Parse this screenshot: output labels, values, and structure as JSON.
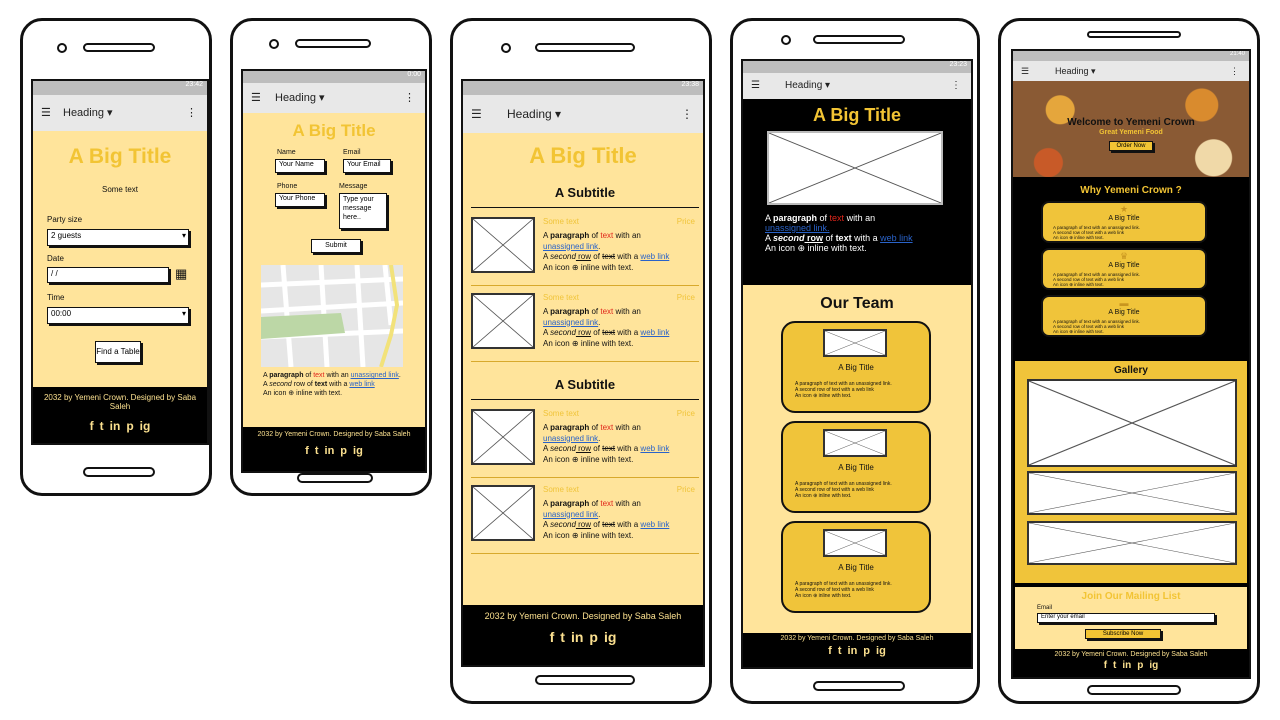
{
  "heading_label": "Heading",
  "menu_icon": "☰",
  "dropdown_icon": "▾",
  "overflow_icon": "⋮",
  "big_title": "A Big Title",
  "footer_text": "2032 by Yemeni Crown. Designed by Saba Saleh",
  "social_icons": [
    "f",
    "t",
    "in",
    "p",
    "ig"
  ],
  "phone1": {
    "time": "23:42",
    "some_text": "Some text",
    "party_label": "Party size",
    "party_value": "2 guests",
    "date_label": "Date",
    "date_value": " /  /",
    "time_label": "Time",
    "time_value": "00:00",
    "button": "Find a Table"
  },
  "phone2": {
    "time": "0:00",
    "name_label": "Name",
    "name_ph": "Your Name",
    "email_label": "Email",
    "email_ph": "Your Email",
    "phone_label": "Phone",
    "phone_ph": "Your Phone",
    "message_label": "Message",
    "message_ph": "Type your message here..",
    "submit": "Submit",
    "para1_a": "A ",
    "para1_b": "paragraph",
    "para1_c": " of ",
    "para1_d": "text",
    "para1_e": " with an ",
    "para1_f": "unassigned link",
    "para2_a": "A ",
    "para2_b": "second",
    "para2_c": " row of ",
    "para2_d": "text",
    "para2_e": " with a ",
    "para2_f": "web link",
    "para3": "An icon ⊕ inline with text."
  },
  "phone3": {
    "time": "23:38",
    "subtitle": "A Subtitle",
    "some_text": "Some text",
    "price": "Price",
    "l1_a": "A ",
    "l1_b": "paragraph",
    "l1_c": " of ",
    "l1_d": "text",
    "l1_e": " with an",
    "l2": "unassigned link",
    "l3_a": "A ",
    "l3_b": "second",
    "l3_c": " row",
    "l3_d": " of ",
    "l3_e": "text",
    "l3_f": " with a ",
    "l3_g": "web link",
    "l4": "An icon ⊕ inline with text."
  },
  "phone4": {
    "time": "23:23",
    "para_a": "A ",
    "para_b": "paragraph",
    "para_c": " of ",
    "para_d": "text",
    "para_e": " with an",
    "link1": "unassigned link.",
    "row2_a": "A ",
    "row2_b": "second",
    "row2_c": " row",
    "row2_d": " of ",
    "row2_e": "text",
    "row2_f": " with a ",
    "row2_g": "web link",
    "row3": "An icon ⊕ inline with text.",
    "team_title": "Our Team",
    "card_title": "A Big Title",
    "card_l1": "A paragraph of text with an unassigned link.",
    "card_l2": "A second row of text with a web link",
    "card_l3": "An icon ⊕ inline with text."
  },
  "phone5": {
    "time": "21:40",
    "hero_title": "Welcome to Yemeni Crown",
    "hero_sub": "Great Yemeni Food",
    "hero_btn": "Order Now",
    "why_title": "Why Yemeni Crown ?",
    "card_title": "A Big Title",
    "card_l1": "A paragraph of text with an unassigned link.",
    "card_l2": "A second row of text with a web link",
    "card_l3": "An icon ⊕ inline with text.",
    "gallery": "Gallery",
    "mail_title": "Join Our Mailing List",
    "email_label": "Email",
    "email_ph": "Enter your email",
    "subscribe": "Subscribe Now"
  },
  "colors": {
    "accent": "#f2c434",
    "pale": "#ffe49b",
    "footer": "#000000",
    "link": "#2a63c9",
    "red": "#e0261b"
  }
}
